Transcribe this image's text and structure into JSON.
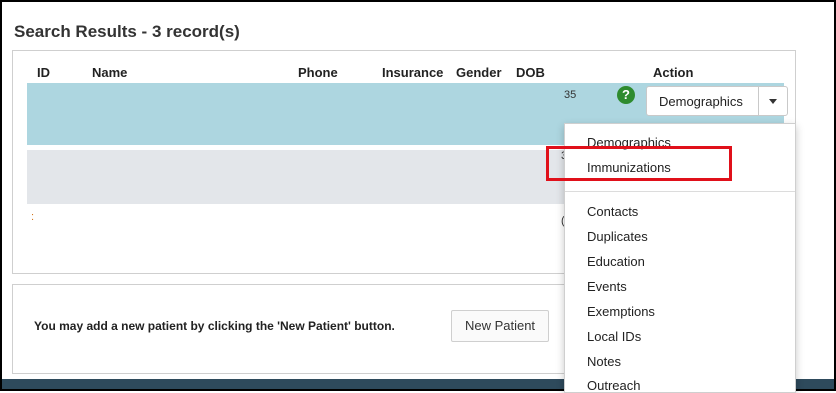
{
  "header": {
    "title": "Search Results - 3 record(s)"
  },
  "table": {
    "columns": [
      "ID",
      "Name",
      "Phone",
      "Insurance",
      "Gender",
      "DOB",
      "Action"
    ],
    "row1_dob_fragment": "35",
    "row2_dob_fragment": "3",
    "row3_id_fragment": ":",
    "row3_dob_fragment": "("
  },
  "action": {
    "selected": "Demographics",
    "help_glyph": "?"
  },
  "dropdown": {
    "items": [
      "Demographics",
      "Immunizations",
      "Contacts",
      "Duplicates",
      "Education",
      "Events",
      "Exemptions",
      "Local IDs",
      "Notes",
      "Outreach"
    ],
    "highlighted": "Immunizations",
    "highlight_color": "#e0101a"
  },
  "footer": {
    "message": "You may add a new patient by clicking the 'New Patient' button.",
    "new_patient_label": "New Patient"
  },
  "colors": {
    "selected_row": "#add6e0",
    "alt_row": "#e3e6ea",
    "help_icon": "#2e8b2e",
    "bottom_bar": "#2e4a5c"
  }
}
